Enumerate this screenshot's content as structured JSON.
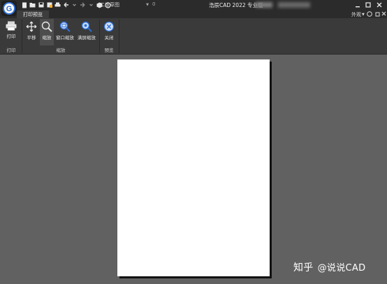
{
  "titlebar": {
    "view_combo": "二维草图",
    "small_text": "0",
    "title": "浩辰CAD 2022 专业版"
  },
  "tabs": [
    {
      "label": "打印预览"
    }
  ],
  "menu_right": {
    "appearance": "外观"
  },
  "ribbon": {
    "buttons": {
      "print": "打印",
      "pan": "平移",
      "zoom": "缩放",
      "window_zoom": "窗口缩放",
      "fullscreen_zoom": "满屏缩放",
      "close": "关闭"
    },
    "groups": {
      "print": "打印",
      "zoom": "缩放",
      "preview": "预览"
    }
  },
  "watermark": {
    "brand": "知乎",
    "handle": "@说说CAD"
  },
  "colors": {
    "titlebar": "#2b2b2b",
    "ribbon": "#3a3a3a",
    "canvas": "#616161",
    "paper": "#ffffff",
    "accent_blue": "#2f6fd6"
  }
}
